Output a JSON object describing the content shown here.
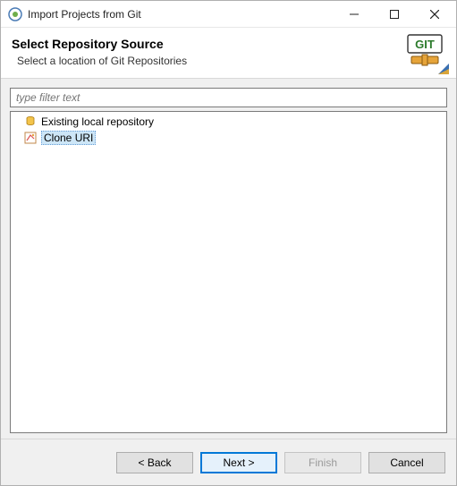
{
  "window": {
    "title": "Import Projects from Git"
  },
  "header": {
    "title": "Select Repository Source",
    "subtitle": "Select a location of Git Repositories",
    "banner_label": "GIT"
  },
  "filter": {
    "placeholder": "type filter text"
  },
  "list": {
    "items": [
      {
        "label": "Existing local repository",
        "icon": "repository-icon",
        "selected": false
      },
      {
        "label": "Clone URI",
        "icon": "clone-uri-icon",
        "selected": true
      }
    ]
  },
  "buttons": {
    "back": "< Back",
    "next": "Next >",
    "finish": "Finish",
    "cancel": "Cancel"
  }
}
